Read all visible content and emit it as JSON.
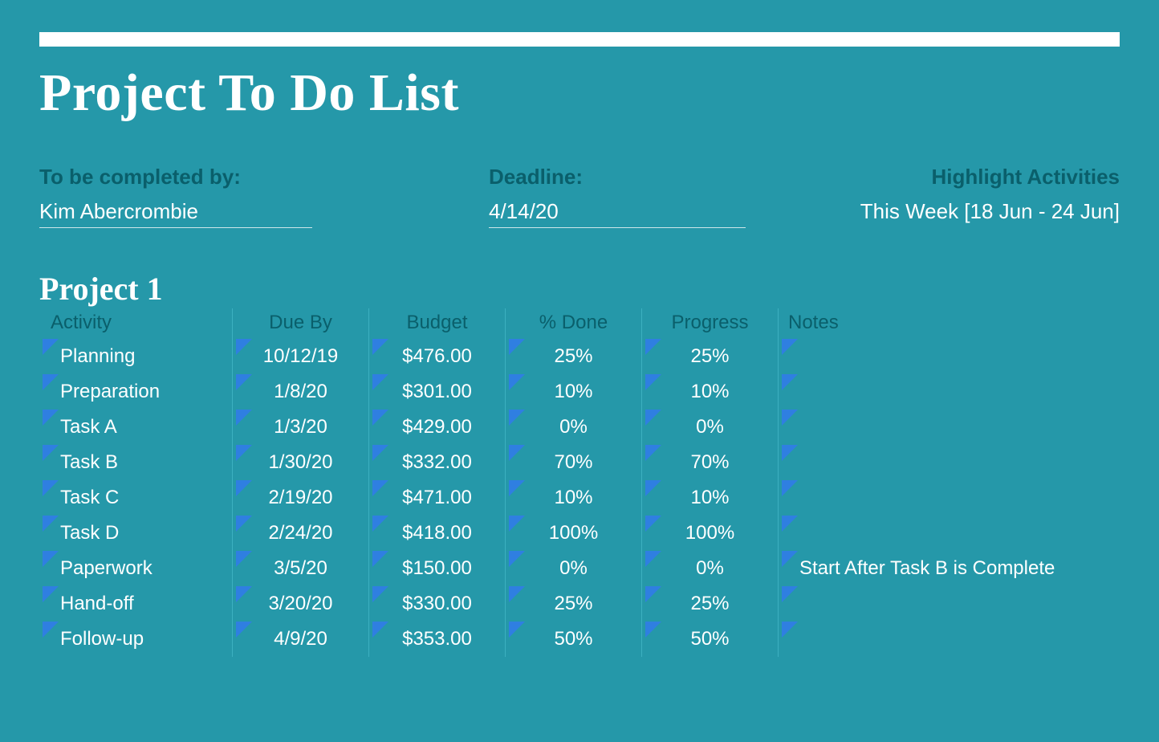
{
  "title": "Project To Do List",
  "meta": {
    "completed_by_label": "To be completed by:",
    "completed_by_value": "Kim Abercrombie",
    "deadline_label": "Deadline:",
    "deadline_value": "4/14/20",
    "highlight_label": "Highlight Activities",
    "highlight_value": "This Week [18 Jun - 24 Jun]"
  },
  "project_heading": "Project 1",
  "columns": {
    "activity": "Activity",
    "due_by": "Due By",
    "budget": "Budget",
    "percent_done": "% Done",
    "progress": "Progress",
    "notes": "Notes"
  },
  "rows": [
    {
      "activity": "Planning",
      "due_by": "10/12/19",
      "budget": "$476.00",
      "percent_done": "25%",
      "progress": "25%",
      "notes": ""
    },
    {
      "activity": "Preparation",
      "due_by": "1/8/20",
      "budget": "$301.00",
      "percent_done": "10%",
      "progress": "10%",
      "notes": ""
    },
    {
      "activity": "Task A",
      "due_by": "1/3/20",
      "budget": "$429.00",
      "percent_done": "0%",
      "progress": "0%",
      "notes": ""
    },
    {
      "activity": "Task B",
      "due_by": "1/30/20",
      "budget": "$332.00",
      "percent_done": "70%",
      "progress": "70%",
      "notes": ""
    },
    {
      "activity": "Task C",
      "due_by": "2/19/20",
      "budget": "$471.00",
      "percent_done": "10%",
      "progress": "10%",
      "notes": ""
    },
    {
      "activity": "Task D",
      "due_by": "2/24/20",
      "budget": "$418.00",
      "percent_done": "100%",
      "progress": "100%",
      "notes": ""
    },
    {
      "activity": "Paperwork",
      "due_by": "3/5/20",
      "budget": "$150.00",
      "percent_done": "0%",
      "progress": "0%",
      "notes": "Start After Task B is Complete"
    },
    {
      "activity": "Hand-off",
      "due_by": "3/20/20",
      "budget": "$330.00",
      "percent_done": "25%",
      "progress": "25%",
      "notes": ""
    },
    {
      "activity": "Follow-up",
      "due_by": "4/9/20",
      "budget": "$353.00",
      "percent_done": "50%",
      "progress": "50%",
      "notes": ""
    }
  ]
}
